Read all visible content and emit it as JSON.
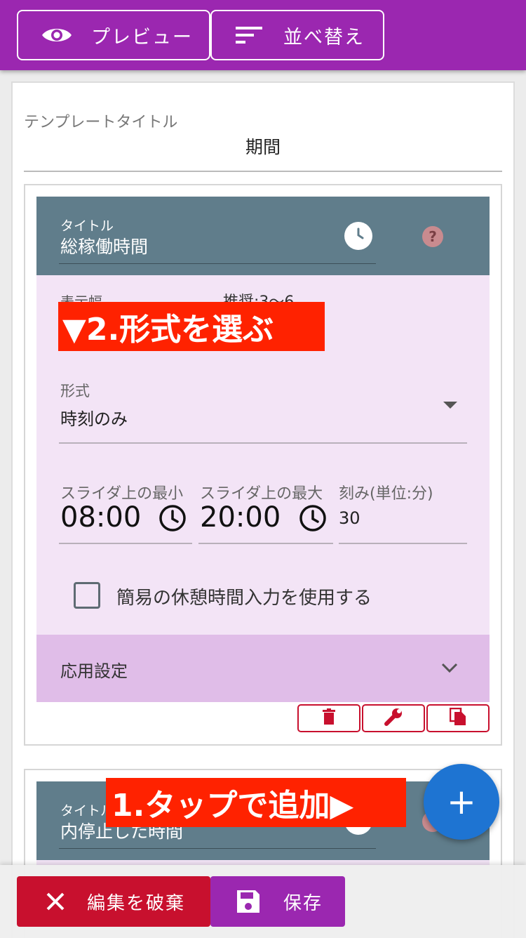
{
  "toolbar": {
    "preview_label": "プレビュー",
    "sort_label": "並べ替え"
  },
  "template": {
    "title_label": "テンプレートタイトル",
    "title_value": "期間"
  },
  "item1": {
    "title_label": "タイトル",
    "title_value": "総稼働時間",
    "help": "?",
    "hidden_label": "表示幅",
    "hidden_value": "推奨:3〜6",
    "format_label": "形式",
    "format_value": "時刻のみ",
    "slider_min_label": "スライダ上の最小",
    "slider_min_value": "08:00",
    "slider_max_label": "スライダ上の最大",
    "slider_max_value": "20:00",
    "step_label": "刻み(単位:分)",
    "step_value": "30",
    "break_checkbox_label": "簡易の休憩時間入力を使用する",
    "break_checked": false,
    "advanced_label": "応用設定"
  },
  "item2": {
    "title_label": "タイトル",
    "title_value": "内停止した時間"
  },
  "annotations": {
    "step2": "▼2.形式を選ぶ",
    "step1": "1.タップで追加▶"
  },
  "fab": {
    "label": "+"
  },
  "bottom": {
    "discard_label": "編集を破棄",
    "save_label": "保存"
  },
  "colors": {
    "primary": "#9b27b0",
    "header": "#607d8b",
    "body": "#f3e4f6",
    "danger": "#c8102e",
    "fab": "#1e74d2",
    "annotation": "#ff2200"
  },
  "icons": [
    "eye-icon",
    "sort-icon",
    "clock-icon",
    "help-icon",
    "chevron-down-icon",
    "trash-icon",
    "wrench-icon",
    "copy-icon",
    "plus-icon",
    "close-icon",
    "save-icon"
  ]
}
